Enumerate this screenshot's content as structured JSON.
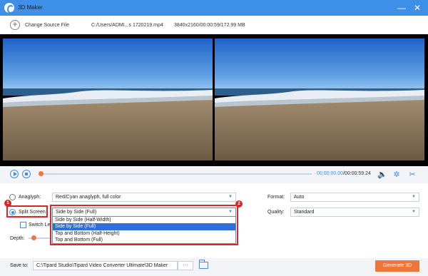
{
  "window": {
    "title": "3D Maker",
    "minimize_glyph": "—",
    "close_glyph": "✕"
  },
  "toolbar": {
    "change_source_label": "Change Source File",
    "add_glyph": "+",
    "file_path": "C:/Users/ADMI...s 1720219.mp4",
    "file_info": "3840x2160/00:00:59/172.99 MB"
  },
  "player": {
    "current_time": "00:00:00.00",
    "total_time": "/00:00:59.24",
    "progress": 0
  },
  "settings": {
    "anaglyph_label": "Anaglyph:",
    "anaglyph_value": "Red/Cyan anaglyph, full color",
    "split_screen_label": "Split Screen",
    "split_screen_value": "Side by Side (Full)",
    "switch_label": "Switch Le",
    "depth_label": "Depth:",
    "format_label": "Format:",
    "format_value": "Auto",
    "quality_label": "Quality:",
    "quality_value": "Standard",
    "arrow_glyph": "▼",
    "split_options": [
      "Side by Side (Half-Width)",
      "Side by Side (Full)",
      "Top and Bottom (Half-Height)",
      "Top and Bottom (Full)"
    ],
    "selected_option_index": 1
  },
  "annotations": {
    "badge_1": "1",
    "badge_2": "2",
    "highlight_color": "#d6282c"
  },
  "footer": {
    "save_to_label": "Save to:",
    "save_path": "C:\\Tipard Studio\\Tipard Video Converter Ultimate\\3D Maker",
    "browse_label": "···",
    "generate_label": "Generate 3D"
  },
  "colors": {
    "accent": "#3d8fe8",
    "orange": "#f0753a",
    "selection": "#2f6fd6"
  },
  "icons": {
    "volume": "🔈",
    "effects": "✲",
    "cut": "✂"
  }
}
